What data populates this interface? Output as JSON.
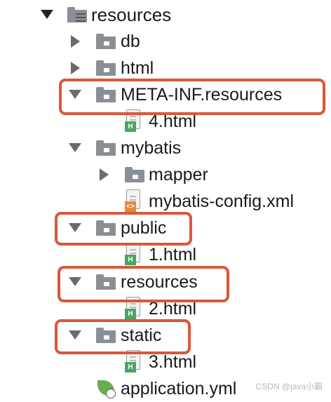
{
  "tree": {
    "root": {
      "label": "resources",
      "icon": "resources-folder-icon"
    },
    "items": [
      {
        "label": "db",
        "type": "folder",
        "expanded": false
      },
      {
        "label": "html",
        "type": "folder",
        "expanded": false
      },
      {
        "label": "META-INF.resources",
        "type": "folder",
        "expanded": true,
        "highlighted": true
      },
      {
        "label": "4.html",
        "type": "html-file"
      },
      {
        "label": "mybatis",
        "type": "folder",
        "expanded": true
      },
      {
        "label": "mapper",
        "type": "folder",
        "expanded": false
      },
      {
        "label": "mybatis-config.xml",
        "type": "xml-file"
      },
      {
        "label": "public",
        "type": "folder",
        "expanded": true,
        "highlighted": true
      },
      {
        "label": "1.html",
        "type": "html-file"
      },
      {
        "label": "resources",
        "type": "folder",
        "expanded": true,
        "highlighted": true
      },
      {
        "label": "2.html",
        "type": "html-file"
      },
      {
        "label": "static",
        "type": "folder",
        "expanded": true,
        "highlighted": true
      },
      {
        "label": "3.html",
        "type": "html-file"
      },
      {
        "label": "application.yml",
        "type": "spring-config-file"
      }
    ]
  },
  "badges": {
    "html": "H",
    "xml": "<>"
  },
  "highlight_color": "#d9583b",
  "watermark": "CSDN @java小霸"
}
